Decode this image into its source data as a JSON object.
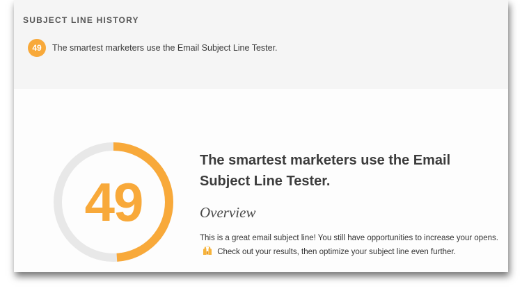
{
  "history": {
    "title": "SUBJECT LINE HISTORY",
    "items": [
      {
        "score": "49",
        "subject": "The smartest marketers use the Email Subject Line Tester."
      }
    ]
  },
  "result": {
    "score": "49",
    "score_fraction": 0.49,
    "headline": "The smartest marketers use the Email Subject Line Tester.",
    "overview_heading": "Overview",
    "overview_part1": "This is a great email subject line! You still have opportunities to increase your opens.",
    "overview_icon": "raised-hands-icon",
    "overview_part2": "Check out your results, then optimize your subject line even further."
  },
  "colors": {
    "accent": "#f8a93a",
    "ring_track": "#e8e8e8"
  }
}
